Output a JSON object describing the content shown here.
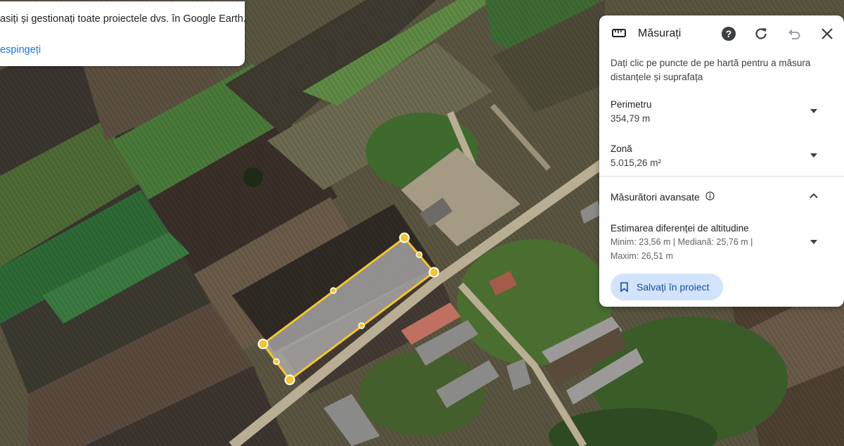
{
  "banner": {
    "message": "asiți și gestionați toate proiectele dvs. în Google Earth.",
    "dismiss_label": "espingeți"
  },
  "measure_panel": {
    "title": "Măsurați",
    "icons": {
      "measure": "ruler-icon",
      "help": "help-icon",
      "refresh": "refresh-icon",
      "undo": "undo-icon",
      "close": "close-icon"
    },
    "instructions": "Dați clic pe puncte de pe hartă pentru a măsura distanțele și suprafața",
    "perimeter": {
      "label": "Perimetru",
      "value": "354,79 m"
    },
    "area": {
      "label": "Zonă",
      "value": "5.015,26 m²"
    },
    "advanced": {
      "title": "Măsurători avansate",
      "altitude": {
        "label": "Estimarea diferenței de altitudine",
        "line1": "Minim: 23,56 m | Mediană: 25,76 m |",
        "line2": "Maxim: 26,51 m"
      }
    },
    "save_label": "Salvați în proiect"
  },
  "colors": {
    "accent": "#1a73e8",
    "save_button_bg": "#d2e3fc",
    "polygon_stroke": "#f4c430"
  }
}
